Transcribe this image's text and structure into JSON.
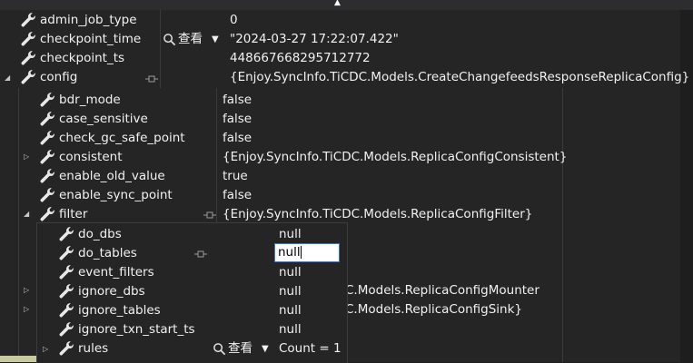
{
  "level1": {
    "rows": [
      {
        "name": "admin_job_type",
        "value": "0"
      },
      {
        "name": "checkpoint_time",
        "value": "\"2024-03-27 17:22:07.422\"",
        "view": "查看"
      },
      {
        "name": "checkpoint_ts",
        "value": "448667668295712772"
      },
      {
        "name": "config",
        "value": "{Enjoy.SyncInfo.TiCDC.Models.CreateChangefeedsResponseReplicaConfig}",
        "expanded": true
      }
    ]
  },
  "level2": {
    "rows": [
      {
        "name": "bdr_mode",
        "value": "false"
      },
      {
        "name": "case_sensitive",
        "value": "false"
      },
      {
        "name": "check_gc_safe_point",
        "value": "false"
      },
      {
        "name": "consistent",
        "value": "{Enjoy.SyncInfo.TiCDC.Models.ReplicaConfigConsistent}",
        "collapsed": true
      },
      {
        "name": "enable_old_value",
        "value": "true"
      },
      {
        "name": "enable_sync_point",
        "value": "false"
      },
      {
        "name": "filter",
        "value": "{Enjoy.SyncInfo.TiCDC.Models.ReplicaConfigFilter}",
        "expanded": true
      }
    ],
    "hidden_tail": [
      {
        "value": "C.Models.ReplicaConfigMounter"
      },
      {
        "value": "C.Models.ReplicaConfigSink}"
      }
    ]
  },
  "level3": {
    "rows": [
      {
        "name": "do_dbs",
        "value": "null"
      },
      {
        "name": "do_tables",
        "value": "null",
        "editing": true
      },
      {
        "name": "event_filters",
        "value": "null"
      },
      {
        "name": "ignore_dbs",
        "value": "null"
      },
      {
        "name": "ignore_tables",
        "value": "null"
      },
      {
        "name": "ignore_txn_start_ts",
        "value": "null"
      },
      {
        "name": "rules",
        "value": "Count = 1",
        "view": "查看",
        "collapsed": true
      }
    ]
  },
  "colors": {
    "background": "#252526",
    "text": "#f1f1f1",
    "edit_border": "#3b78d8"
  }
}
